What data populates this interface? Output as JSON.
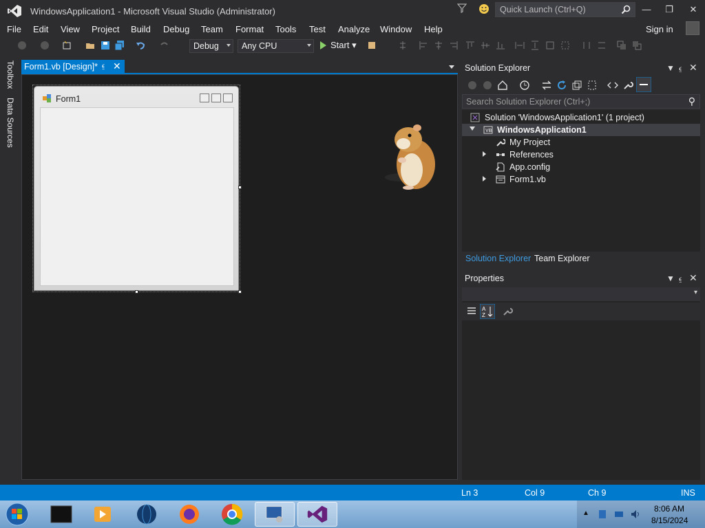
{
  "window": {
    "title": "WindowsApplication1 - Microsoft Visual Studio (Administrator)",
    "quick_launch_placeholder": "Quick Launch (Ctrl+Q)",
    "sign_in": "Sign in"
  },
  "menu": [
    "File",
    "Edit",
    "View",
    "Project",
    "Build",
    "Debug",
    "Team",
    "Format",
    "Tools",
    "Test",
    "Analyze",
    "Window",
    "Help"
  ],
  "toolbar": {
    "configuration": "Debug",
    "platform": "Any CPU",
    "start_label": "Start"
  },
  "side_tabs": [
    "Toolbox",
    "Data Sources"
  ],
  "document_tab": {
    "label": "Form1.vb [Design]*"
  },
  "designer": {
    "form_title": "Form1"
  },
  "solution_explorer": {
    "title": "Solution Explorer",
    "search_placeholder": "Search Solution Explorer (Ctrl+;)",
    "tree": [
      {
        "label": "Solution 'WindowsApplication1' (1 project)",
        "level": 0,
        "icon": "solution-icon"
      },
      {
        "label": "WindowsApplication1",
        "level": 1,
        "icon": "vb-project-icon",
        "expanded": true,
        "selected": true
      },
      {
        "label": "My Project",
        "level": 2,
        "icon": "wrench-icon"
      },
      {
        "label": "References",
        "level": 2,
        "icon": "references-icon",
        "expandable": true
      },
      {
        "label": "App.config",
        "level": 2,
        "icon": "config-file-icon"
      },
      {
        "label": "Form1.vb",
        "level": 2,
        "icon": "form-file-icon",
        "expandable": true
      }
    ],
    "tabs": [
      "Solution Explorer",
      "Team Explorer"
    ]
  },
  "properties": {
    "title": "Properties"
  },
  "status": {
    "line": "Ln 3",
    "col": "Col 9",
    "ch": "Ch 9",
    "mode": "INS"
  },
  "taskbar": {
    "time": "8:06 AM",
    "date": "8/15/2024",
    "apps": [
      "terminal-app-icon",
      "media-player-icon",
      "network-globe-icon",
      "firefox-icon",
      "chrome-icon",
      "remote-desktop-icon",
      "visual-studio-icon"
    ]
  },
  "colors": {
    "accent": "#007acc",
    "background": "#2d2d30",
    "designer": "#1e1e1e"
  }
}
